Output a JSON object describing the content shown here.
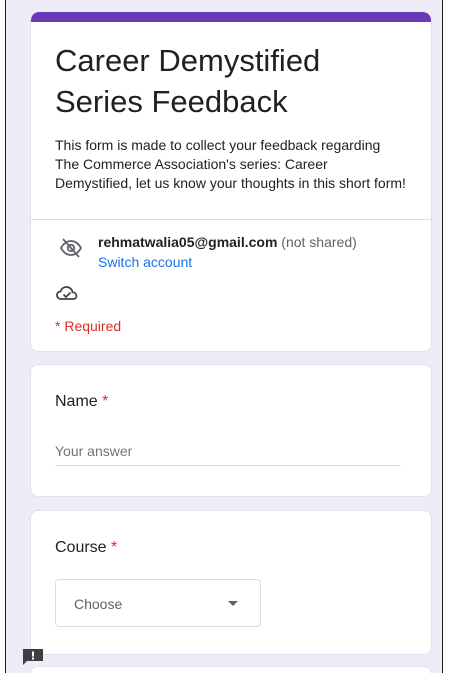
{
  "form": {
    "title": "Career Demystified Series Feedback",
    "description": "This form is made to collect your feedback regarding The Commerce Association's series: Career Demystified, let us know your thoughts in this short form!",
    "account": {
      "email": "rehmatwalia05@gmail.com",
      "not_shared": "(not shared)",
      "switch_label": "Switch account",
      "icon": "eye-off-icon"
    },
    "draft_icon": "cloud-check-icon",
    "required_note": "* Required",
    "accent_color": "#673ab7"
  },
  "questions": {
    "name": {
      "label": "Name",
      "required_mark": "*",
      "placeholder": "Your answer"
    },
    "course": {
      "label": "Course",
      "required_mark": "*",
      "selected": "Choose"
    }
  },
  "feedback_icon": "report-feedback-icon"
}
